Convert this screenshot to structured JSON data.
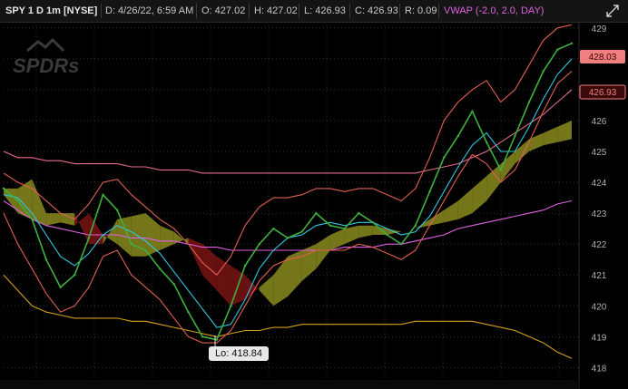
{
  "header": {
    "symbol": "SPY 1 D 1m [NYSE]",
    "date": "D: 4/26/22, 6:59 AM",
    "open": "O: 427.02",
    "high": "H: 427.02",
    "low": "L: 426.93",
    "close": "C: 426.93",
    "range": "R: 0.09",
    "study": "VWAP (-2.0, 2.0, DAY)"
  },
  "watermark": "SPDRs",
  "price_labels": {
    "upper": "428.03",
    "lower": "426.93"
  },
  "low_label": "Lo: 418.84",
  "colors": {
    "background": "#000000",
    "vwap": "#e060e0",
    "price_label_bg": "#f08080",
    "cloud_bull": "#8a8a1e",
    "cloud_bear": "#7a1414"
  },
  "chart_data": {
    "type": "line",
    "symbol": "SPY",
    "interval": "1m",
    "ylim": [
      417.6,
      429.2
    ],
    "y_ticks": [
      418,
      419,
      420,
      421,
      422,
      423,
      424,
      425,
      426,
      427,
      428,
      429
    ],
    "grid": true,
    "x": [
      0,
      5,
      10,
      15,
      20,
      25,
      30,
      35,
      40,
      45,
      50,
      55,
      60,
      65,
      70,
      75,
      80,
      85,
      90,
      95,
      100,
      105,
      110,
      115,
      120,
      125,
      130,
      135,
      140,
      145,
      150,
      155,
      160,
      165,
      170,
      175,
      180,
      185,
      190,
      195,
      200
    ],
    "series": [
      {
        "role": "price",
        "color": "#3fb03f",
        "values": [
          423.8,
          423.4,
          422.8,
          421.5,
          420.6,
          421.0,
          422.2,
          423.6,
          423.1,
          422.0,
          421.8,
          421.2,
          420.7,
          419.8,
          419.0,
          418.9,
          420.0,
          421.3,
          422.0,
          422.5,
          422.2,
          422.4,
          423.0,
          422.6,
          422.5,
          423.0,
          422.7,
          422.3,
          422.0,
          422.6,
          423.7,
          424.8,
          425.5,
          426.3,
          425.3,
          424.4,
          425.5,
          426.6,
          427.6,
          428.3,
          428.5
        ]
      },
      {
        "role": "fast_ma",
        "color": "#30c8e0",
        "values": [
          423.6,
          423.5,
          423.0,
          422.3,
          421.6,
          421.3,
          421.7,
          422.3,
          422.6,
          422.4,
          422.1,
          421.7,
          421.1,
          420.5,
          419.9,
          419.3,
          419.4,
          420.2,
          421.2,
          421.8,
          422.2,
          422.3,
          422.6,
          422.7,
          422.6,
          422.7,
          422.7,
          422.5,
          422.3,
          422.4,
          422.9,
          423.7,
          424.5,
          425.2,
          425.6,
          425.0,
          425.0,
          425.8,
          426.7,
          427.5,
          428.0
        ]
      },
      {
        "role": "vwap",
        "color": "#e060e0",
        "values": [
          423.4,
          423.1,
          422.8,
          422.6,
          422.5,
          422.4,
          422.3,
          422.3,
          422.3,
          422.2,
          422.2,
          422.1,
          422.1,
          422.0,
          421.9,
          421.9,
          421.8,
          421.8,
          421.8,
          421.8,
          421.8,
          421.8,
          421.8,
          421.8,
          421.9,
          421.9,
          421.9,
          422.0,
          422.0,
          422.1,
          422.2,
          422.3,
          422.5,
          422.6,
          422.7,
          422.8,
          422.9,
          423.0,
          423.1,
          423.3,
          423.4
        ]
      },
      {
        "role": "upper_band",
        "color": "#e86a8a",
        "values": [
          425.0,
          424.8,
          424.8,
          424.7,
          424.7,
          424.6,
          424.6,
          424.6,
          424.6,
          424.5,
          424.5,
          424.4,
          424.4,
          424.4,
          424.3,
          424.3,
          424.3,
          424.3,
          424.3,
          424.3,
          424.3,
          424.3,
          424.3,
          424.3,
          424.3,
          424.3,
          424.3,
          424.3,
          424.3,
          424.3,
          424.4,
          424.5,
          424.6,
          424.8,
          425.0,
          425.3,
          425.6,
          425.9,
          426.2,
          426.6,
          427.0
        ]
      },
      {
        "role": "lower_band",
        "color": "#d4a020",
        "values": [
          421.0,
          420.5,
          420.0,
          419.8,
          419.7,
          419.6,
          419.6,
          419.6,
          419.6,
          419.5,
          419.5,
          419.4,
          419.3,
          419.2,
          419.1,
          419.0,
          419.1,
          419.2,
          419.2,
          419.3,
          419.3,
          419.4,
          419.4,
          419.4,
          419.4,
          419.4,
          419.4,
          419.4,
          419.4,
          419.5,
          419.5,
          419.5,
          419.5,
          419.5,
          419.4,
          419.3,
          419.2,
          419.0,
          418.8,
          418.5,
          418.3
        ]
      },
      {
        "role": "envelope_upper",
        "color": "#e06050",
        "values": [
          424.3,
          424.0,
          423.8,
          423.4,
          423.0,
          422.8,
          423.3,
          424.0,
          424.1,
          423.6,
          423.2,
          422.8,
          422.5,
          422.0,
          421.4,
          421.0,
          421.6,
          422.6,
          423.2,
          423.5,
          423.5,
          423.6,
          423.8,
          423.8,
          423.7,
          423.8,
          423.8,
          423.6,
          423.4,
          423.8,
          424.8,
          426.0,
          426.6,
          427.0,
          427.3,
          426.6,
          427.0,
          427.8,
          428.6,
          429.0,
          429.1
        ]
      },
      {
        "role": "envelope_lower",
        "color": "#e06050",
        "values": [
          423.0,
          422.0,
          421.2,
          420.4,
          419.8,
          420.0,
          420.6,
          421.6,
          421.8,
          421.0,
          420.6,
          420.2,
          419.6,
          419.0,
          418.8,
          418.8,
          419.2,
          420.0,
          420.8,
          421.3,
          421.5,
          421.6,
          421.8,
          421.8,
          421.8,
          422.0,
          421.9,
          421.7,
          421.5,
          421.8,
          422.6,
          423.4,
          424.2,
          424.9,
          424.6,
          424.0,
          424.4,
          425.3,
          426.3,
          427.2,
          427.6
        ]
      }
    ],
    "cloud": {
      "span_a": [
        423.8,
        423.8,
        424.1,
        423.0,
        423.0,
        423.0,
        422.0,
        422.0,
        422.8,
        422.9,
        423.0,
        422.6,
        422.4,
        422.0,
        421.0,
        420.5,
        420.0,
        420.2,
        420.6,
        421.0,
        421.6,
        421.8,
        422.0,
        422.3,
        422.5,
        422.6,
        422.6,
        422.5,
        422.4,
        422.5,
        422.8,
        423.1,
        423.4,
        423.8,
        424.2,
        424.6,
        425.0,
        425.4,
        425.6,
        425.8,
        426.0
      ],
      "span_b": [
        423.6,
        423.0,
        422.8,
        422.6,
        422.7,
        422.6,
        423.0,
        422.3,
        422.0,
        421.6,
        421.6,
        421.8,
        422.0,
        422.2,
        422.0,
        421.6,
        421.3,
        421.0,
        420.5,
        420.0,
        420.3,
        420.8,
        421.2,
        421.8,
        422.0,
        422.2,
        422.3,
        422.3,
        422.4,
        422.5,
        422.6,
        422.7,
        422.8,
        423.0,
        423.4,
        424.0,
        424.6,
        425.0,
        425.2,
        425.3,
        425.4
      ]
    },
    "annotations": [
      {
        "text": "Lo: 418.84",
        "value": 418.84
      }
    ]
  }
}
